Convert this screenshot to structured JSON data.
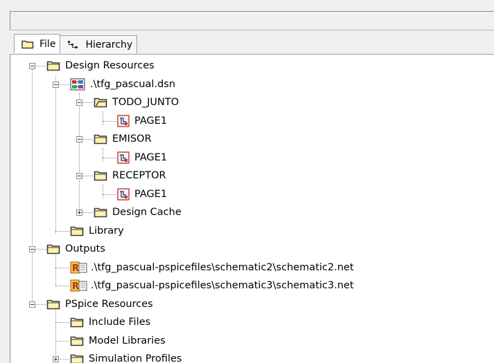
{
  "tabs": [
    {
      "label": "File",
      "icon": "folder-icon",
      "active": true
    },
    {
      "label": "Hierarchy",
      "icon": "hierarchy-icon",
      "active": false
    }
  ],
  "tree": {
    "design_resources": "Design Resources",
    "dsn_file": ".\\tfg_pascual.dsn",
    "todo_junto": "TODO_JUNTO",
    "todo_junto_page": "PAGE1",
    "emisor": "EMISOR",
    "emisor_page": "PAGE1",
    "receptor": "RECEPTOR",
    "receptor_page": "PAGE1",
    "design_cache": "Design Cache",
    "library": "Library",
    "outputs": "Outputs",
    "output_1": ".\\tfg_pascual-pspicefiles\\schematic2\\schematic2.net",
    "output_2": ".\\tfg_pascual-pspicefiles\\schematic3\\schematic3.net",
    "pspice_resources": "PSpice Resources",
    "include_files": "Include Files",
    "model_libraries": "Model Libraries",
    "simulation_profiles": "Simulation Profiles"
  },
  "colors": {
    "folder_fill": "#fff3b0",
    "folder_stroke": "#3a3a3a",
    "dotted_line": "#8a8a8a"
  }
}
